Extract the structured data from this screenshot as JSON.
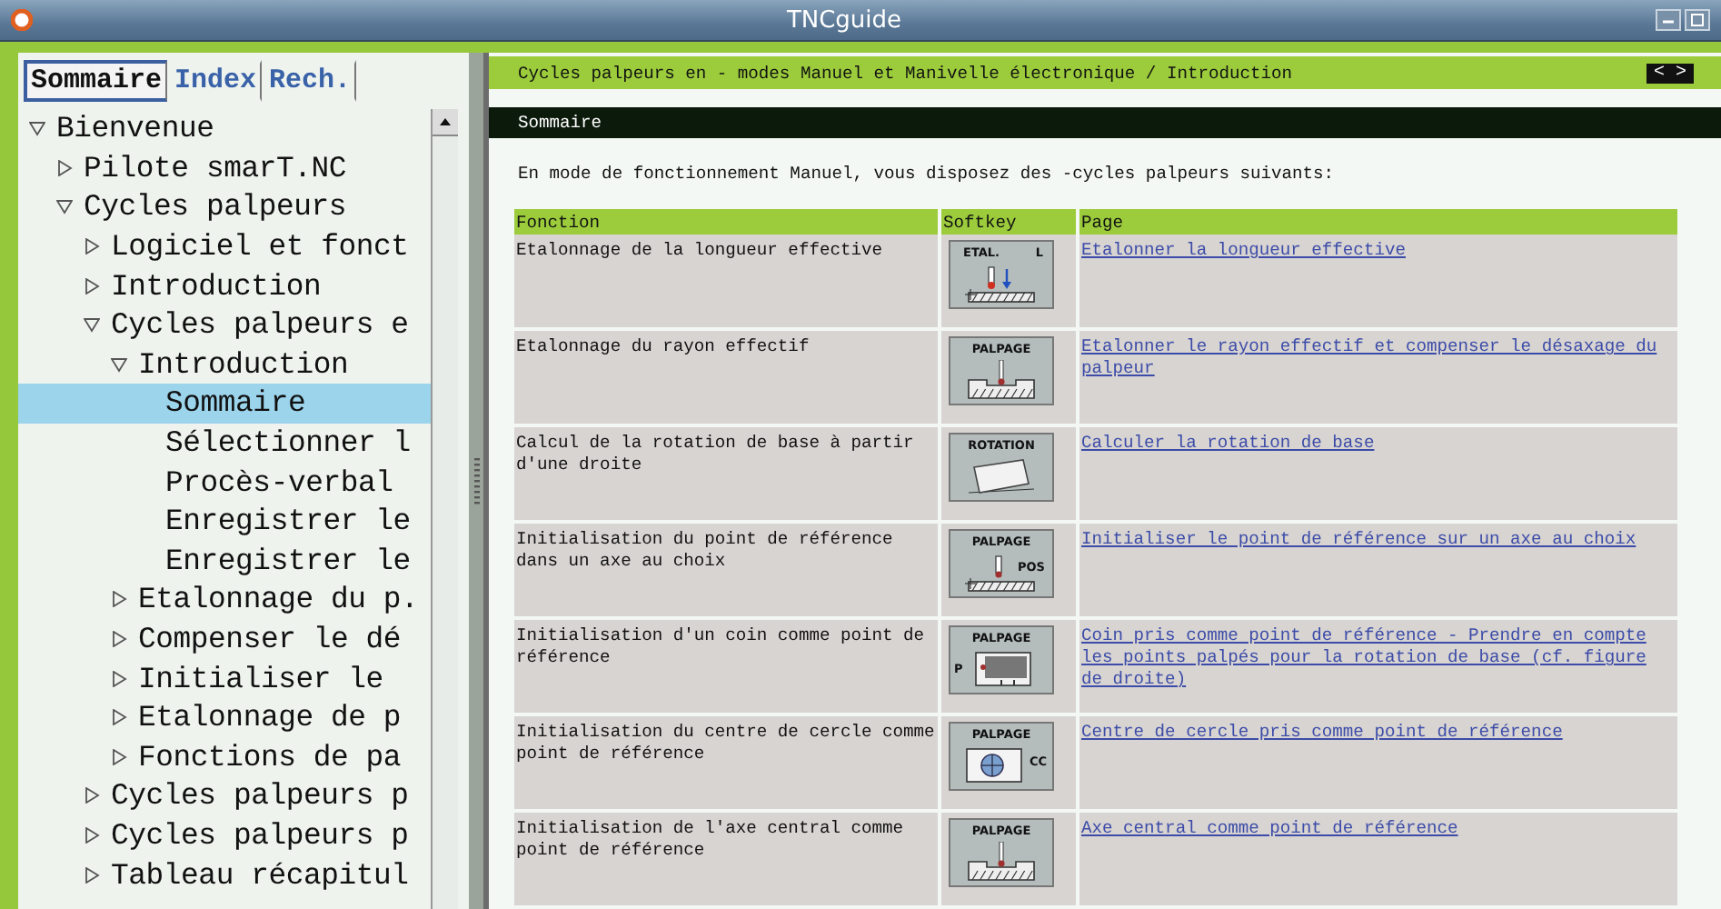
{
  "window": {
    "title": "TNCguide"
  },
  "tabs": [
    {
      "label": "Sommaire",
      "selected": true
    },
    {
      "label": "Index",
      "selected": false
    },
    {
      "label": "Rech.",
      "selected": false
    }
  ],
  "tree": [
    {
      "label": "Bienvenue",
      "expanded": true,
      "selected": false,
      "children": [
        {
          "label": "Pilote smarT.NC",
          "expanded": false,
          "selected": false
        },
        {
          "label": "Cycles palpeurs",
          "expanded": true,
          "selected": false,
          "children": [
            {
              "label": "Logiciel et fonct",
              "expanded": false,
              "selected": false
            },
            {
              "label": "Introduction",
              "expanded": false,
              "selected": false
            },
            {
              "label": "Cycles palpeurs e",
              "expanded": true,
              "selected": false,
              "children": [
                {
                  "label": "Introduction",
                  "expanded": true,
                  "selected": false,
                  "children": [
                    {
                      "label": "Sommaire",
                      "selected": true
                    },
                    {
                      "label": "Sélectionner l",
                      "selected": false
                    },
                    {
                      "label": "Procès-verbal",
                      "selected": false
                    },
                    {
                      "label": "Enregistrer le",
                      "selected": false
                    },
                    {
                      "label": "Enregistrer le",
                      "selected": false
                    }
                  ]
                },
                {
                  "label": "Etalonnage du p.",
                  "expanded": false,
                  "selected": false
                },
                {
                  "label": "Compenser le dé",
                  "expanded": false,
                  "selected": false
                },
                {
                  "label": "Initialiser le",
                  "expanded": false,
                  "selected": false
                },
                {
                  "label": "Etalonnage de p",
                  "expanded": false,
                  "selected": false
                },
                {
                  "label": "Fonctions de pa",
                  "expanded": false,
                  "selected": false
                }
              ]
            },
            {
              "label": "Cycles palpeurs p",
              "expanded": false,
              "selected": false
            },
            {
              "label": "Cycles palpeurs p",
              "expanded": false,
              "selected": false
            },
            {
              "label": "Tableau récapitul",
              "expanded": false,
              "selected": false
            }
          ]
        }
      ]
    }
  ],
  "breadcrumb": "Cycles palpeurs en - modes Manuel et Manivelle électronique / Introduction",
  "nav": {
    "prev": "<",
    "next": ">"
  },
  "section_title": "Sommaire",
  "intro": "En mode de fonctionnement Manuel, vous disposez des -cycles palpeurs suivants:",
  "table": {
    "columns": [
      "Fonction",
      "Softkey",
      "Page"
    ],
    "rows": [
      {
        "fonction": "Etalonnage de la longueur effective",
        "softkey": {
          "kind": "length",
          "label": "ETAL.",
          "sublabel": "L"
        },
        "page": "Etalonner la longueur effective"
      },
      {
        "fonction": "Etalonnage du rayon effectif",
        "softkey": {
          "kind": "groove",
          "label": "PALPAGE"
        },
        "page": "Etalonner le rayon effectif et compenser le désaxage du palpeur"
      },
      {
        "fonction": "Calcul de la rotation de base à partir d'une droite",
        "softkey": {
          "kind": "rotation",
          "label": "ROTATION"
        },
        "page": "Calculer la rotation de base"
      },
      {
        "fonction": "Initialisation du point de référence dans un axe au choix",
        "softkey": {
          "kind": "axis",
          "label": "PALPAGE",
          "sublabel": "POS"
        },
        "page": "Initialiser le point de référence sur un axe au choix"
      },
      {
        "fonction": "Initialisation d'un coin comme point de référence",
        "softkey": {
          "kind": "corner",
          "label": "PALPAGE",
          "sublabel": "P"
        },
        "page": "Coin pris comme point de référence - Prendre en compte les points palpés pour la rotation de base (cf. figure de droite)"
      },
      {
        "fonction": "Initialisation du centre de cercle comme point de référence",
        "softkey": {
          "kind": "circle",
          "label": "PALPAGE",
          "sublabel": "CC"
        },
        "page": "Centre de cercle pris comme point de référence"
      },
      {
        "fonction": "Initialisation de l'axe central comme point de référence",
        "softkey": {
          "kind": "groove",
          "label": "PALPAGE"
        },
        "page": "Axe central comme point de référence"
      }
    ]
  }
}
